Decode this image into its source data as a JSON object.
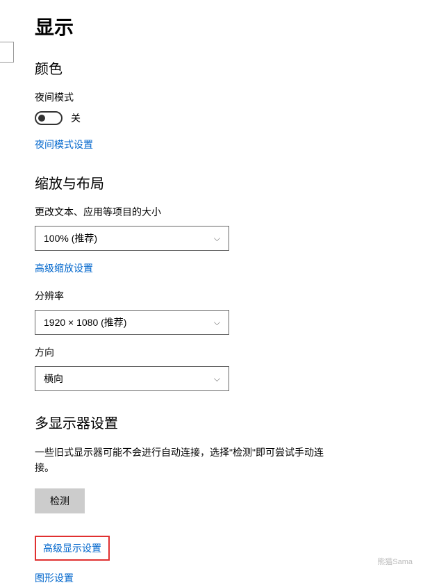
{
  "page": {
    "title": "显示"
  },
  "color": {
    "section_title": "颜色",
    "night_mode_label": "夜间模式",
    "night_mode_state": "关",
    "night_mode_settings_link": "夜间模式设置"
  },
  "scale_layout": {
    "section_title": "缩放与布局",
    "scale_label": "更改文本、应用等项目的大小",
    "scale_value": "100% (推荐)",
    "advanced_scale_link": "高级缩放设置",
    "resolution_label": "分辨率",
    "resolution_value": "1920 × 1080 (推荐)",
    "orientation_label": "方向",
    "orientation_value": "横向"
  },
  "multi_display": {
    "section_title": "多显示器设置",
    "description": "一些旧式显示器可能不会进行自动连接，选择\"检测\"即可尝试手动连接。",
    "detect_button": "检测",
    "advanced_display_link": "高级显示设置",
    "graphics_settings_link": "图形设置"
  },
  "watermark": "熊猫Sama"
}
